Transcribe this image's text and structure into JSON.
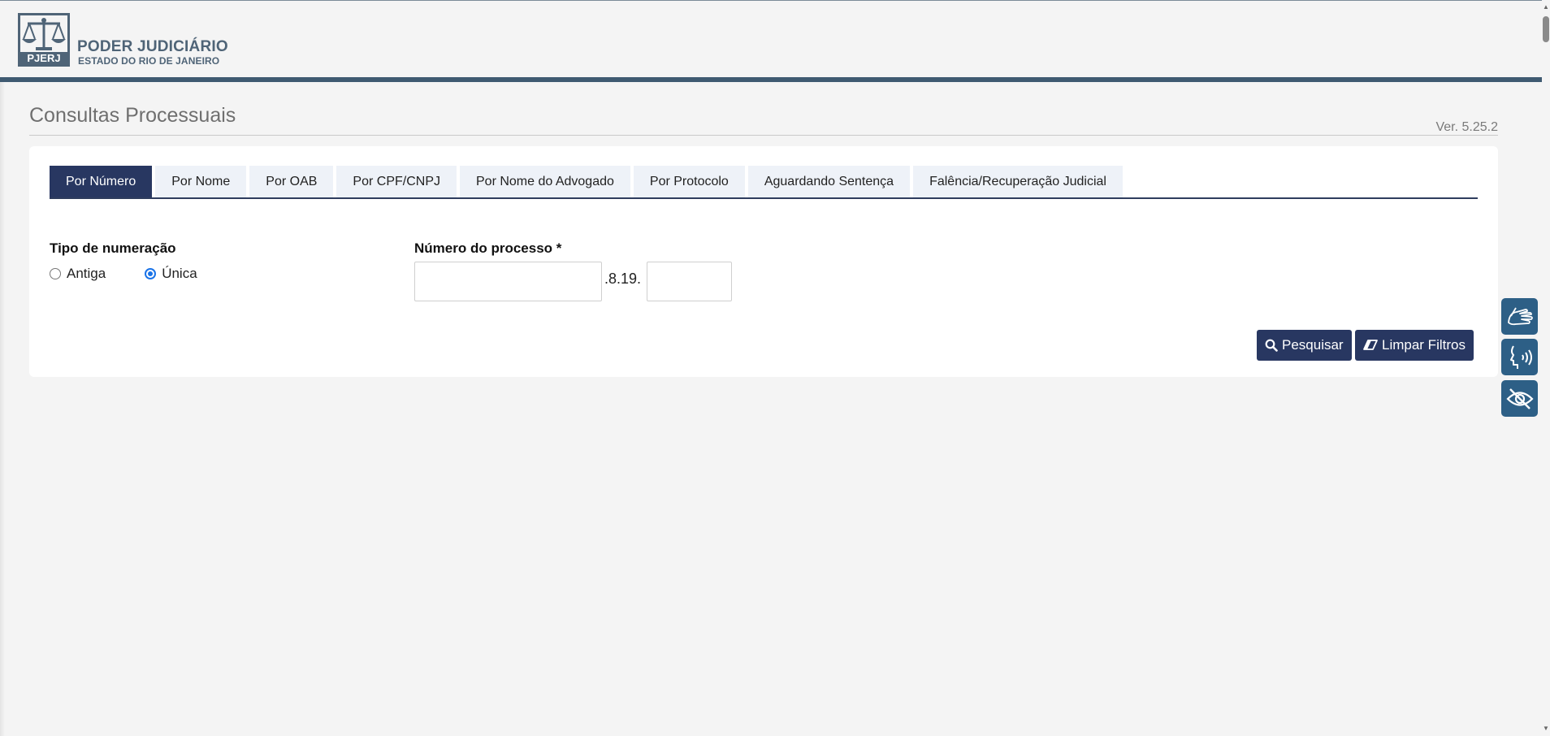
{
  "header": {
    "logo_text": "PJERJ",
    "title": "PODER JUDICIÁRIO",
    "subtitle": "ESTADO DO RIO DE JANEIRO"
  },
  "page": {
    "title": "Consultas Processuais",
    "version": "Ver. 5.25.2"
  },
  "tabs": [
    {
      "label": "Por Número",
      "active": true
    },
    {
      "label": "Por Nome",
      "active": false
    },
    {
      "label": "Por OAB",
      "active": false
    },
    {
      "label": "Por CPF/CNPJ",
      "active": false
    },
    {
      "label": "Por Nome do Advogado",
      "active": false
    },
    {
      "label": "Por Protocolo",
      "active": false
    },
    {
      "label": "Aguardando Sentença",
      "active": false
    },
    {
      "label": "Falência/Recuperação Judicial",
      "active": false
    }
  ],
  "form": {
    "numbering_label": "Tipo de numeração",
    "options": [
      {
        "label": "Antiga",
        "checked": false
      },
      {
        "label": "Única",
        "checked": true
      }
    ],
    "process_label": "Número do processo *",
    "process_value": "",
    "separator": ".8.19.",
    "origin_value": ""
  },
  "actions": {
    "search_label": "Pesquisar",
    "clear_label": "Limpar Filtros"
  },
  "accessibility": [
    {
      "icon": "sign-language-icon"
    },
    {
      "icon": "speech-icon"
    },
    {
      "icon": "eye-slash-icon"
    }
  ],
  "colors": {
    "primary": "#283761",
    "header_bar": "#3f5a71",
    "accessibility": "#2d5f86",
    "tab_inactive": "#eef2f8"
  }
}
